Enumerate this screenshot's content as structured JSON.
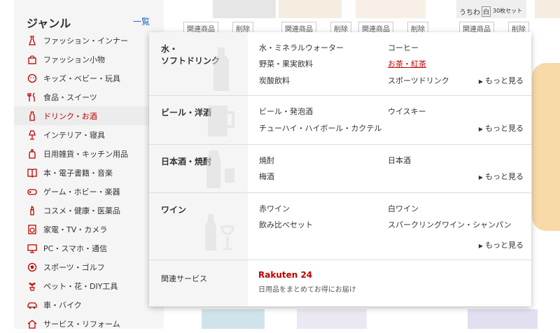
{
  "sidebar": {
    "title": "ジャンル",
    "more": "一覧",
    "items": [
      {
        "label": "ファッション・インナー",
        "icon": "dress-icon"
      },
      {
        "label": "ファッション小物",
        "icon": "bag-icon"
      },
      {
        "label": "キッズ・ベビー・玩具",
        "icon": "baby-icon"
      },
      {
        "label": "食品・スイーツ",
        "icon": "fork-knife-icon"
      },
      {
        "label": "ドリンク・お酒",
        "icon": "bottle-icon"
      },
      {
        "label": "インテリア・寝具",
        "icon": "lamp-icon"
      },
      {
        "label": "日用雑貨・キッチン用品",
        "icon": "detergent-icon"
      },
      {
        "label": "本・電子書籍・音楽",
        "icon": "book-icon"
      },
      {
        "label": "ゲーム・ホビー・楽器",
        "icon": "gamepad-icon"
      },
      {
        "label": "コスメ・健康・医薬品",
        "icon": "lipstick-icon"
      },
      {
        "label": "家電・TV・カメラ",
        "icon": "washer-icon"
      },
      {
        "label": "PC・スマホ・通信",
        "icon": "pc-icon"
      },
      {
        "label": "スポーツ・ゴルフ",
        "icon": "ball-icon"
      },
      {
        "label": "ペット・花・DIY工具",
        "icon": "plant-icon"
      },
      {
        "label": "車・バイク",
        "icon": "car-icon"
      },
      {
        "label": "サービス・リフォーム",
        "icon": "house-icon"
      }
    ]
  },
  "product_strip": {
    "related_label": "関連商品",
    "delete_label": "削除",
    "thumb_text": "うちわ",
    "thumb_badge": "白",
    "thumb_sub": "30枚セット"
  },
  "flyout": {
    "sections": [
      {
        "category": [
          "水・",
          "ソフトドリンク"
        ],
        "links": [
          "水・ミネラルウォーター",
          "コーヒー",
          "野菜・果実飲料",
          "お茶・紅茶",
          "炭酸飲料",
          "スポーツドリンク"
        ],
        "highlighted": "お茶・紅茶",
        "more": "もっと見る"
      },
      {
        "category": [
          "ビール・洋酒"
        ],
        "links": [
          "ビール・発泡酒",
          "ウイスキー",
          "チューハイ・ハイボール・カクテル"
        ],
        "more": "もっと見る"
      },
      {
        "category": [
          "日本酒・焼酎"
        ],
        "links": [
          "焼酎",
          "日本酒",
          "梅酒"
        ],
        "more": "もっと見る"
      },
      {
        "category": [
          "ワイン"
        ],
        "links": [
          "赤ワイン",
          "白ワイン",
          "飲み比べセット",
          "スパークリングワイン・シャンパン"
        ],
        "more": "もっと見る"
      }
    ],
    "services": {
      "label": "関連サービス",
      "logo": "Rakuten 24",
      "description": "日用品をまとめてお得にお届け"
    }
  },
  "colors": {
    "accent": "#bf0000",
    "link": "#1a66c4",
    "panel_bg": "#f5f5f5"
  }
}
